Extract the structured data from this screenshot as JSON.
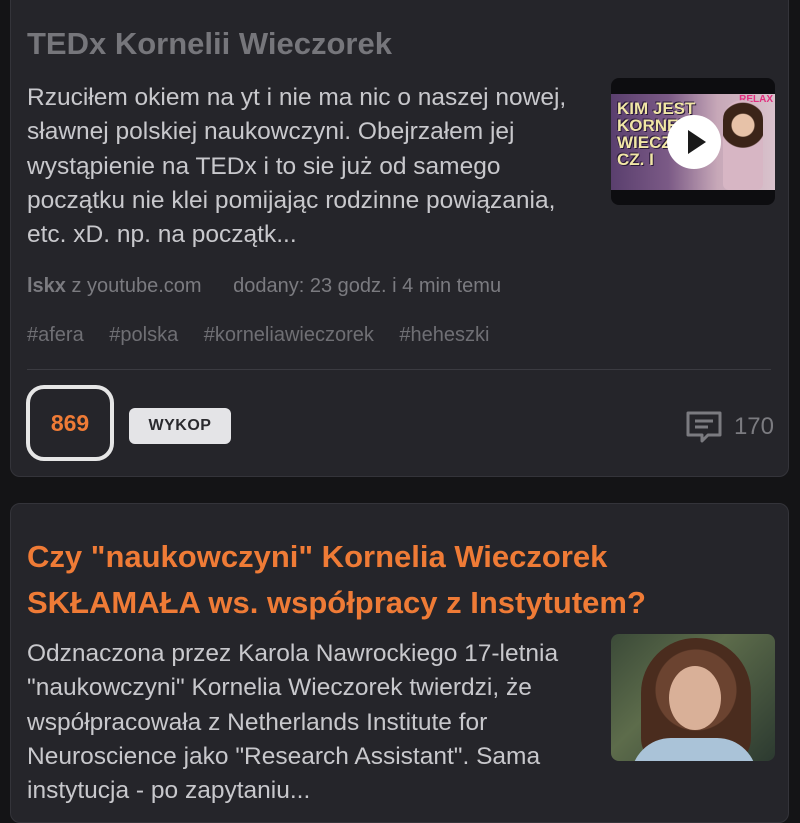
{
  "posts": [
    {
      "title": "TEDx Kornelii Wieczorek",
      "excerpt": "Rzuciłem okiem na yt i nie ma nic o naszej nowej, sławnej polskiej naukowczyni. Obejrzałem jej wystąpienie na TEDx i to sie już od samego początku nie klei pomijając rodzinne powiązania, etc. xD. np. na początk...",
      "thumbnail": {
        "text": "KIM JEST\nKORNEL\nWIECZO\nCZ. I",
        "tag": "RELAX",
        "icon": "play-icon"
      },
      "author": "lskx",
      "source": "z youtube.com",
      "added": "dodany: 23 godz. i 4 min temu",
      "tags": [
        "#afera",
        "#polska",
        "#korneliawieczorek",
        "#heheszki"
      ],
      "votes": "869",
      "vote_button": "WYKOP",
      "comments": "170"
    },
    {
      "title": "Czy \"naukowczyni\" Kornelia Wieczorek SKŁAMAŁA ws. współpracy z Instytutem?",
      "excerpt": "Odznaczona przez Karola Nawrockiego 17-letnia \"naukowczyni\" Kornelia Wieczorek twierdzi, że współpracowała z Netherlands Institute for Neuroscience jako \"Research Assistant\". Sama instytucja - po zapytaniu..."
    }
  ],
  "colors": {
    "background": "#141416",
    "card": "#25252a",
    "accent": "#ef7b36",
    "muted_text": "#7b7b80"
  }
}
